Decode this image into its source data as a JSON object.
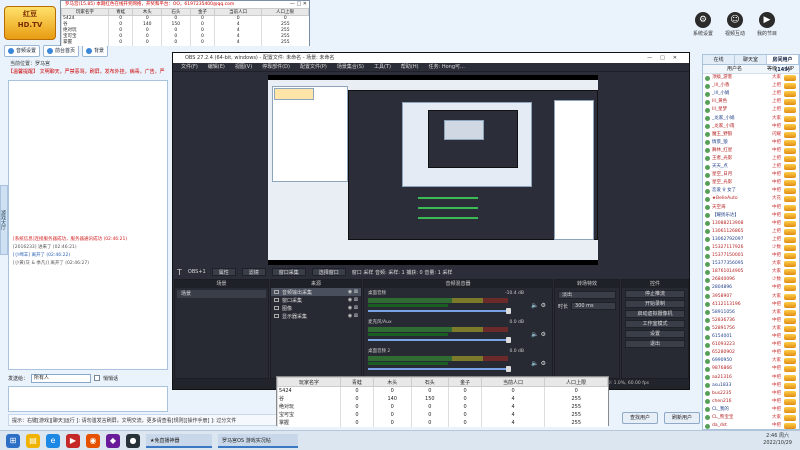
{
  "chat": {
    "logo_line1": "红豆",
    "logo_line2": "HD.TV",
    "nav": [
      "音频设置",
      "前台首页",
      "背景"
    ],
    "room_title": "当前位置：罗马宫",
    "announcement": "【温馨提醒】 文明聊天，严禁恶骂，刷屏，发布外挂，病毒，广告，严",
    "log": [
      {
        "cls": "sys",
        "text": "[系统信息]连接服务器成功，服务器通讯成功 (02:46:21)"
      },
      {
        "cls": "",
        "text": "[2016233] 进来了 (02:46:21)"
      },
      {
        "cls": "blue",
        "text": "[小绵羊] 离开了 (02:46:22)"
      },
      {
        "cls": "",
        "text": "[小黄(灰 & 季凡)] 离开了 (02:46:27)"
      }
    ],
    "side_tab": "游戏大厅",
    "target_label": "发送给：",
    "target_value": "所有人",
    "private_label": "悄悄话",
    "hint": "提示：右键[游戏][聊天]运行  ]: 请勿滥发言刷屏，文明交流，更多请查看[规则][操作手册]  ]: 过分文件",
    "toolbar": [
      {
        "glyph": "⚙",
        "label": "系统设置"
      },
      {
        "glyph": "☺",
        "label": "视频互动"
      },
      {
        "glyph": "▶",
        "label": "我的节目"
      },
      {
        "glyph": "♫",
        "label": "点歌"
      }
    ],
    "userlist": {
      "tabs": [
        "在线",
        "聊天室",
        "房间用户(149)"
      ],
      "head": [
        "用户名",
        "等级",
        "VIP"
      ],
      "users": [
        {
          "name": "顶级_游客",
          "rank": "大家"
        },
        {
          "name": "_Ill_小香",
          "rank": "上把"
        },
        {
          "name": "_Ill_小娟",
          "rank": "上把"
        },
        {
          "name": "Ill_黄色",
          "rank": "上把"
        },
        {
          "name": "Ill_星梦",
          "rank": "上把"
        },
        {
          "name": "_龙家_小娟",
          "rank": "大家"
        },
        {
          "name": "_龙家_小雨",
          "rank": "中把"
        },
        {
          "name": "魔王_野狼",
          "rank": "闪耀"
        },
        {
          "name": "情景_狼",
          "rank": "中把"
        },
        {
          "name": "舞林_红星",
          "rank": "中把"
        },
        {
          "name": "王者_光影",
          "rank": "上把"
        },
        {
          "name": "天天_点",
          "rank": "上把"
        },
        {
          "name": "星空_日月",
          "rank": "中把"
        },
        {
          "name": "星空_光影",
          "rank": "中把"
        },
        {
          "name": "恋爱 ♀ 女了",
          "rank": "中把"
        },
        {
          "name": "★BelieAuto",
          "rank": "大花"
        },
        {
          "name": "天空海",
          "rank": "中把"
        },
        {
          "name": "【耀扬乐达】",
          "rank": "中把"
        },
        {
          "name": "13088213908",
          "rank": "中把"
        },
        {
          "name": "13061126865",
          "rank": "上把"
        },
        {
          "name": "13062792097",
          "rank": "上把"
        },
        {
          "name": "15327117926",
          "rank": "少数"
        },
        {
          "name": "15377150001",
          "rank": "中把"
        },
        {
          "name": "15377356095",
          "rank": "大家"
        },
        {
          "name": "18761014905",
          "rank": "大家"
        },
        {
          "name": "26840096",
          "rank": "少数"
        },
        {
          "name": "2804896",
          "rank": "中把"
        },
        {
          "name": "3958907",
          "rank": "大家"
        },
        {
          "name": "4112113196",
          "rank": "中把"
        },
        {
          "name": "58911056",
          "rank": "大家"
        },
        {
          "name": "52836736",
          "rank": "中把"
        },
        {
          "name": "52891756",
          "rank": "大家"
        },
        {
          "name": "6154001",
          "rank": "中把"
        },
        {
          "name": "61093223",
          "rank": "中把"
        },
        {
          "name": "65280902",
          "rank": "中把"
        },
        {
          "name": "6990950",
          "rank": "大家"
        },
        {
          "name": "9876866",
          "rank": "中把"
        },
        {
          "name": "aa21316",
          "rank": "中把"
        },
        {
          "name": "asu1833",
          "rank": "中把"
        },
        {
          "name": "bus2235",
          "rank": "中把"
        },
        {
          "name": "chen216",
          "rank": "中把"
        },
        {
          "name": "CL_我的",
          "rank": "中把"
        },
        {
          "name": "CL_熊宝宝",
          "rank": "大家"
        },
        {
          "name": "da_dst",
          "rank": "中把"
        },
        {
          "name": "dnnbs",
          "rank": "中把"
        }
      ]
    },
    "bottom_buttons": [
      "查找用户",
      "刷新用户"
    ]
  },
  "stats_window": {
    "title": "罗马宫(15.85) 本期红色在线开奖网络，开奖和平台：OO，6197235400@qq.com",
    "controls": "—  □  ✕",
    "headers": [
      "玩家名字",
      "青蛙",
      "木头",
      "石头",
      "金子",
      "当前人口",
      "人口上限"
    ],
    "rows": [
      [
        "5424",
        "0",
        "0",
        "0",
        "0",
        "0",
        "0"
      ],
      [
        "谷",
        "0",
        "140",
        "150",
        "0",
        "4",
        "255"
      ],
      [
        "绝对玩",
        "0",
        "0",
        "0",
        "0",
        "4",
        "255"
      ],
      [
        "宝可宝",
        "0",
        "0",
        "0",
        "0",
        "4",
        "255"
      ],
      [
        "掌握",
        "0",
        "0",
        "0",
        "0",
        "4",
        "255"
      ]
    ]
  },
  "obs": {
    "title": "OBS 27.2.4 (64-bit, windows) - 配置文件: 未命名 - 场景: 未命名",
    "menu": [
      "文件(F)",
      "编辑(E)",
      "视图(V)",
      "停靠部件(D)",
      "配置文件(P)",
      "场景集合(S)",
      "工具(T)",
      "帮助(H)",
      "任务: Hong可..."
    ],
    "scene_bar": {
      "label": "OBS+1",
      "buttons": [
        "属性",
        "滤镜",
        "窗口采集",
        "选择窗口"
      ],
      "extra": "窗口 采样   音频: 采样: 1   捕获: 0   音量: 1   采样"
    },
    "docks": {
      "scenes": {
        "title": "场景",
        "items": [
          "场景"
        ]
      },
      "sources": {
        "title": "来源",
        "items": [
          "音频输出采集",
          "窗口采集",
          "图像",
          "显示器采集"
        ]
      },
      "mixer": {
        "title": "音频混音器",
        "channels": [
          {
            "label": "桌面音频",
            "db": "-10.4 dB"
          },
          {
            "label": "麦克风/Aux",
            "db": "0.0 dB"
          },
          {
            "label": "桌面音频 2",
            "db": "0.0 dB"
          }
        ]
      },
      "transitions": {
        "title": "转场特效",
        "mode": "淡出",
        "duration_label": "时长",
        "duration": "300 ms"
      },
      "controls": {
        "title": "控件",
        "buttons": [
          "停止推流",
          "开始录制",
          "启动虚拟摄像机",
          "工作室模式",
          "设置",
          "退出"
        ]
      }
    },
    "statusbar": "LIVE: 00:00:00   REC: 00:00:00   CPU: 1.0%, 60.00 fps",
    "scene_footer": "+ − ∧ ∨"
  },
  "overlay_table": {
    "headers": [
      "玩家名字",
      "青蛙",
      "木头",
      "石头",
      "金子",
      "当前人口",
      "人口上限"
    ],
    "rows": [
      [
        "5424",
        "0",
        "0",
        "0",
        "0",
        "0",
        "0"
      ],
      [
        "谷",
        "0",
        "140",
        "150",
        "0",
        "4",
        "255"
      ],
      [
        "绝对玩",
        "0",
        "0",
        "0",
        "0",
        "4",
        "255"
      ],
      [
        "宝可宝",
        "0",
        "0",
        "0",
        "0",
        "4",
        "255"
      ],
      [
        "掌握",
        "0",
        "0",
        "0",
        "0",
        "4",
        "255"
      ]
    ]
  },
  "taskbar": {
    "tasks": [
      "★免直播神器",
      "罗马宫OS 游戏实况帖"
    ],
    "tray_time": "2:46",
    "tray_day": "周六",
    "tray_date": "2022/10/29"
  }
}
